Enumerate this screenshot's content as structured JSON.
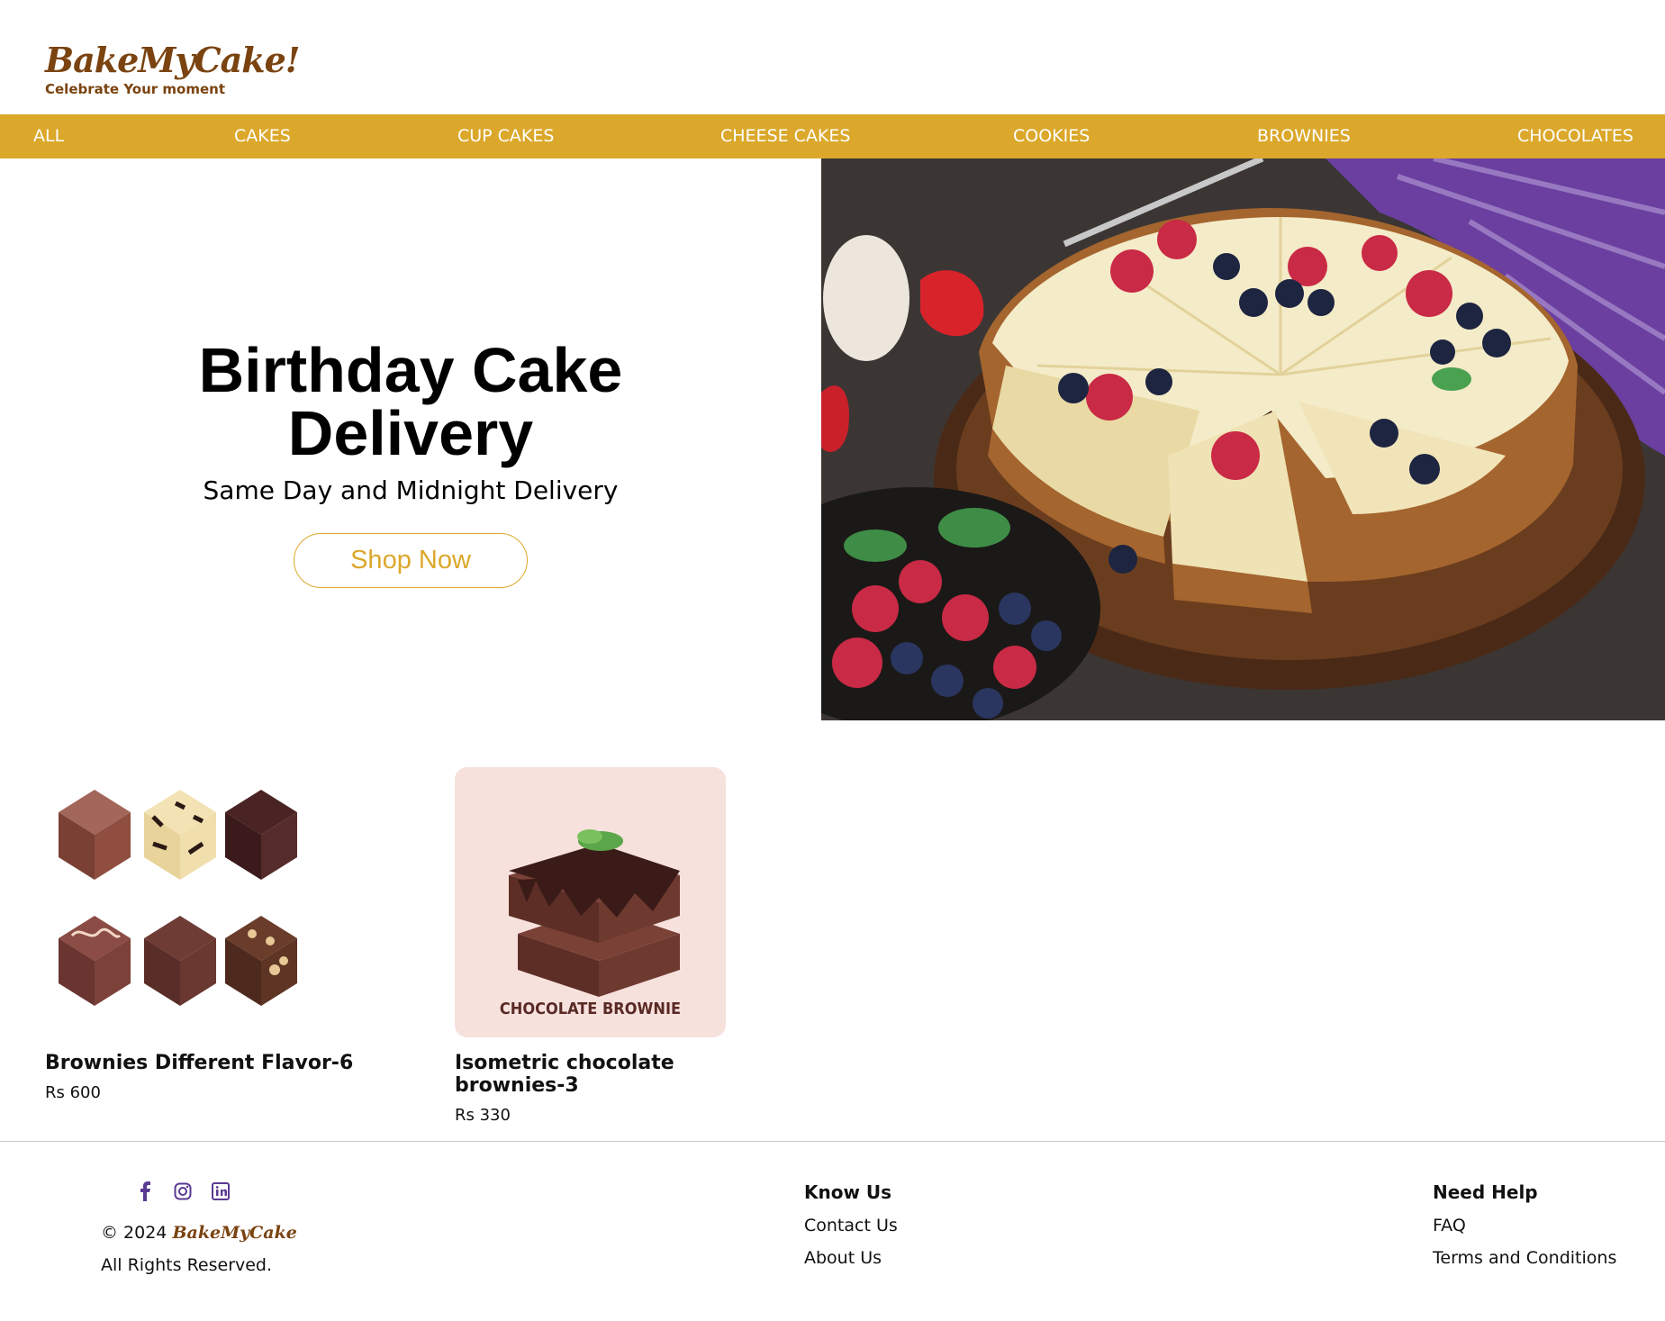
{
  "brand": {
    "name": "BakeMyCake!",
    "tagline": "Celebrate Your moment",
    "color": "#7a4310"
  },
  "nav": {
    "items": [
      "ALL",
      "CAKES",
      "CUP CAKES",
      "CHEESE CAKES",
      "COOKIES",
      "BROWNIES",
      "CHOCOLATES"
    ],
    "background": "#dba82b"
  },
  "hero": {
    "title_line1": "Birthday Cake",
    "title_line2": "Delivery",
    "subtitle": "Same Day and Midnight Delivery",
    "cta_label": "Shop Now",
    "image_icon": "cheesecake-photo"
  },
  "products": [
    {
      "name": "Brownies Different Flavor-6",
      "price": "Rs 600",
      "image_icon": "six-brownies-illustration"
    },
    {
      "name": "Isometric chocolate brownies-3",
      "price": "Rs 330",
      "image_icon": "chocolate-brownie-stack-illustration",
      "image_caption": "CHOCOLATE BROWNIE"
    }
  ],
  "footer": {
    "socials": [
      "facebook-icon",
      "instagram-icon",
      "linkedin-icon"
    ],
    "copyright_prefix": "© 2024",
    "copyright_brand": "BakeMyCake",
    "rights": "All Rights Reserved.",
    "know_us": {
      "heading": "Know Us",
      "links": [
        "Contact Us",
        "About Us"
      ]
    },
    "need_help": {
      "heading": "Need Help",
      "links": [
        "FAQ",
        "Terms and Conditions"
      ]
    }
  }
}
